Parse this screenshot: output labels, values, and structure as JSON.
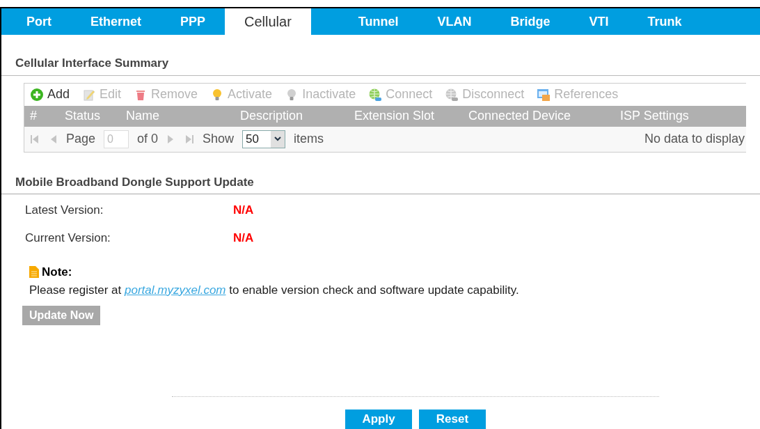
{
  "tabs": [
    {
      "label": "Port",
      "selected": false
    },
    {
      "label": "Ethernet",
      "selected": false
    },
    {
      "label": "PPP",
      "selected": false
    },
    {
      "label": "Cellular",
      "selected": true
    },
    {
      "label": "Tunnel",
      "selected": false
    },
    {
      "label": "VLAN",
      "selected": false
    },
    {
      "label": "Bridge",
      "selected": false
    },
    {
      "label": "VTI",
      "selected": false
    },
    {
      "label": "Trunk",
      "selected": false
    }
  ],
  "summary": {
    "title": "Cellular Interface Summary",
    "toolbar": [
      {
        "kind": "add",
        "label": "Add",
        "disabled": false
      },
      {
        "kind": "edit",
        "label": "Edit",
        "disabled": true
      },
      {
        "kind": "remove",
        "label": "Remove",
        "disabled": true
      },
      {
        "kind": "activate",
        "label": "Activate",
        "disabled": true
      },
      {
        "kind": "inactivate",
        "label": "Inactivate",
        "disabled": true
      },
      {
        "kind": "connect",
        "label": "Connect",
        "disabled": true
      },
      {
        "kind": "disconnect",
        "label": "Disconnect",
        "disabled": true
      },
      {
        "kind": "references",
        "label": "References",
        "disabled": true
      }
    ],
    "columns": [
      "#",
      "Status",
      "Name",
      "Description",
      "Extension Slot",
      "Connected Device",
      "ISP Settings"
    ],
    "pager": {
      "page_label": "Page",
      "page_value": "0",
      "of": "of 0",
      "show_label": "Show",
      "per_page": "50",
      "items_label": "items",
      "message": "No data to display"
    }
  },
  "dongle": {
    "title": "Mobile Broadband Dongle Support Update",
    "fields": [
      {
        "label": "Latest Version:",
        "value": "N/A"
      },
      {
        "label": "Current Version:",
        "value": "N/A"
      }
    ],
    "note": {
      "title": "Note:",
      "before": "Please register at",
      "link": "portal.myzyxel.com",
      "after": "to enable version check and software update capability."
    },
    "update_button": {
      "label": "Update Now",
      "disabled": true
    }
  },
  "buttons": [
    "Apply",
    "Reset"
  ]
}
